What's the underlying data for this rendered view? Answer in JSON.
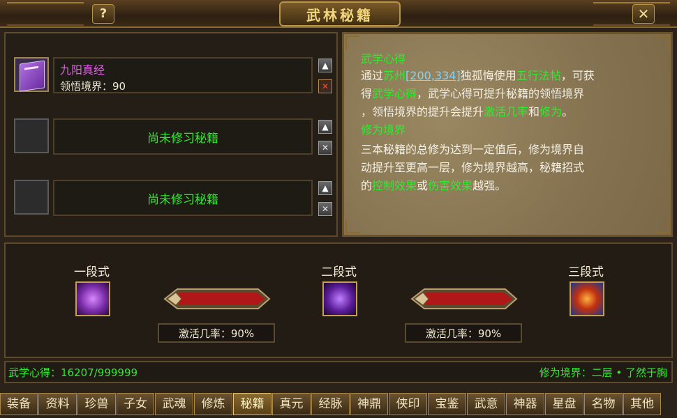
{
  "window": {
    "title": "武林秘籍",
    "help_label": "?",
    "close_label": "✕"
  },
  "slots": [
    {
      "name": "九阳真经",
      "level": "领悟境界：90",
      "empty": false
    },
    {
      "empty_text": "尚未修习秘籍",
      "empty": true
    },
    {
      "empty_text": "尚未修习秘籍",
      "empty": true
    }
  ],
  "buttons": {
    "up": "▲",
    "remove": "✕"
  },
  "info": {
    "section1_title": "武学心得",
    "line1_a": "通过",
    "line1_city": "苏州",
    "line1_coord": "[200,334]",
    "line1_b": "独孤悔使用",
    "line1_item": "五行法帖",
    "line1_c": "，可获",
    "line2_a": "得",
    "line2_hl": "武学心得",
    "line2_b": "，武学心得可提升秘籍的领悟境界",
    "line3_a": "，领悟境界的提升会提升",
    "line3_hl1": "激活几率",
    "line3_b": "和",
    "line3_hl2": "修为",
    "line3_c": "。",
    "section2_title": "修为境界",
    "line4": "三本秘籍的总修为达到一定值后，修为境界自",
    "line5": "动提升至更高一层，修为境界越高，秘籍招式",
    "line6_a": "的",
    "line6_hl1": "控制效果",
    "line6_b": "或",
    "line6_hl2": "伤害效果",
    "line6_c": "越强。"
  },
  "stages": {
    "stage1": "一段式",
    "stage2": "二段式",
    "stage3": "三段式",
    "rate1": "激活几率：90%",
    "rate2": "激活几率：90%"
  },
  "status": {
    "insight": "武学心得：16207/999999",
    "realm": "修为境界：二层 • 了然于胸"
  },
  "tabs": [
    "装备",
    "资料",
    "珍兽",
    "子女",
    "武魂",
    "修炼",
    "秘籍",
    "真元",
    "经脉",
    "神鼎",
    "侠印",
    "宝鉴",
    "武意",
    "神器",
    "星盘",
    "名物",
    "其他"
  ],
  "selected_tab": "秘籍",
  "colors": {
    "accent_green": "#30ea30",
    "item_purple": "#e060e8",
    "link_blue": "#7fd4ff"
  }
}
